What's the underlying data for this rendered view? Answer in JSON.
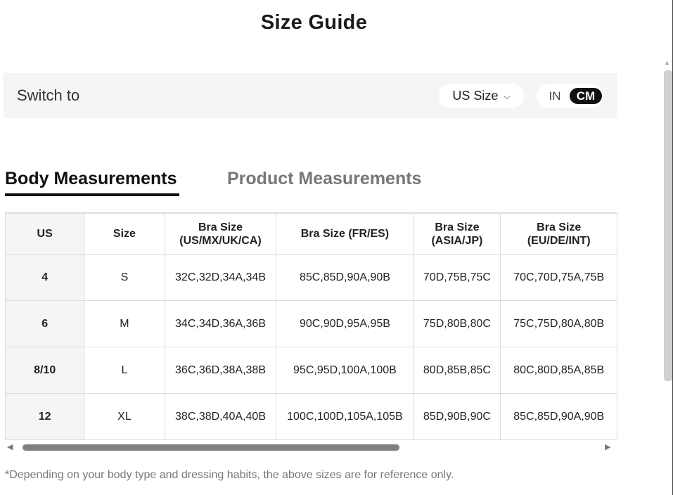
{
  "title": "Size Guide",
  "switch_bar": {
    "label": "Switch to",
    "size_select": {
      "value": "US Size",
      "chevron_icon": "chevron-down-icon"
    },
    "units": {
      "in_label": "IN",
      "cm_label": "CM",
      "selected": "CM"
    }
  },
  "tabs": [
    {
      "label": "Body Measurements",
      "active": true
    },
    {
      "label": "Product Measurements",
      "active": false
    }
  ],
  "table": {
    "headers": [
      [
        "US"
      ],
      [
        "Size"
      ],
      [
        "Bra Size",
        "(US/MX/UK/CA)"
      ],
      [
        "Bra Size (FR/ES)"
      ],
      [
        "Bra Size",
        "(ASIA/JP)"
      ],
      [
        "Bra Size",
        "(EU/DE/INT)"
      ]
    ],
    "rows": [
      [
        "4",
        "S",
        "32C,32D,34A,34B",
        "85C,85D,90A,90B",
        "70D,75B,75C",
        "70C,70D,75A,75B"
      ],
      [
        "6",
        "M",
        "34C,34D,36A,36B",
        "90C,90D,95A,95B",
        "75D,80B,80C",
        "75C,75D,80A,80B"
      ],
      [
        "8/10",
        "L",
        "36C,36D,38A,38B",
        "95C,95D,100A,100B",
        "80D,85B,85C",
        "80C,80D,85A,85B"
      ],
      [
        "12",
        "XL",
        "38C,38D,40A,40B",
        "100C,100D,105A,105B",
        "85D,90B,90C",
        "85C,85D,90A,90B"
      ]
    ]
  },
  "scrollbar": {
    "left_icon": "triangle-left-icon",
    "right_icon": "triangle-right-icon",
    "visible_fraction": 0.62
  },
  "note": "*Depending on your body type and dressing habits, the above sizes are for reference only."
}
